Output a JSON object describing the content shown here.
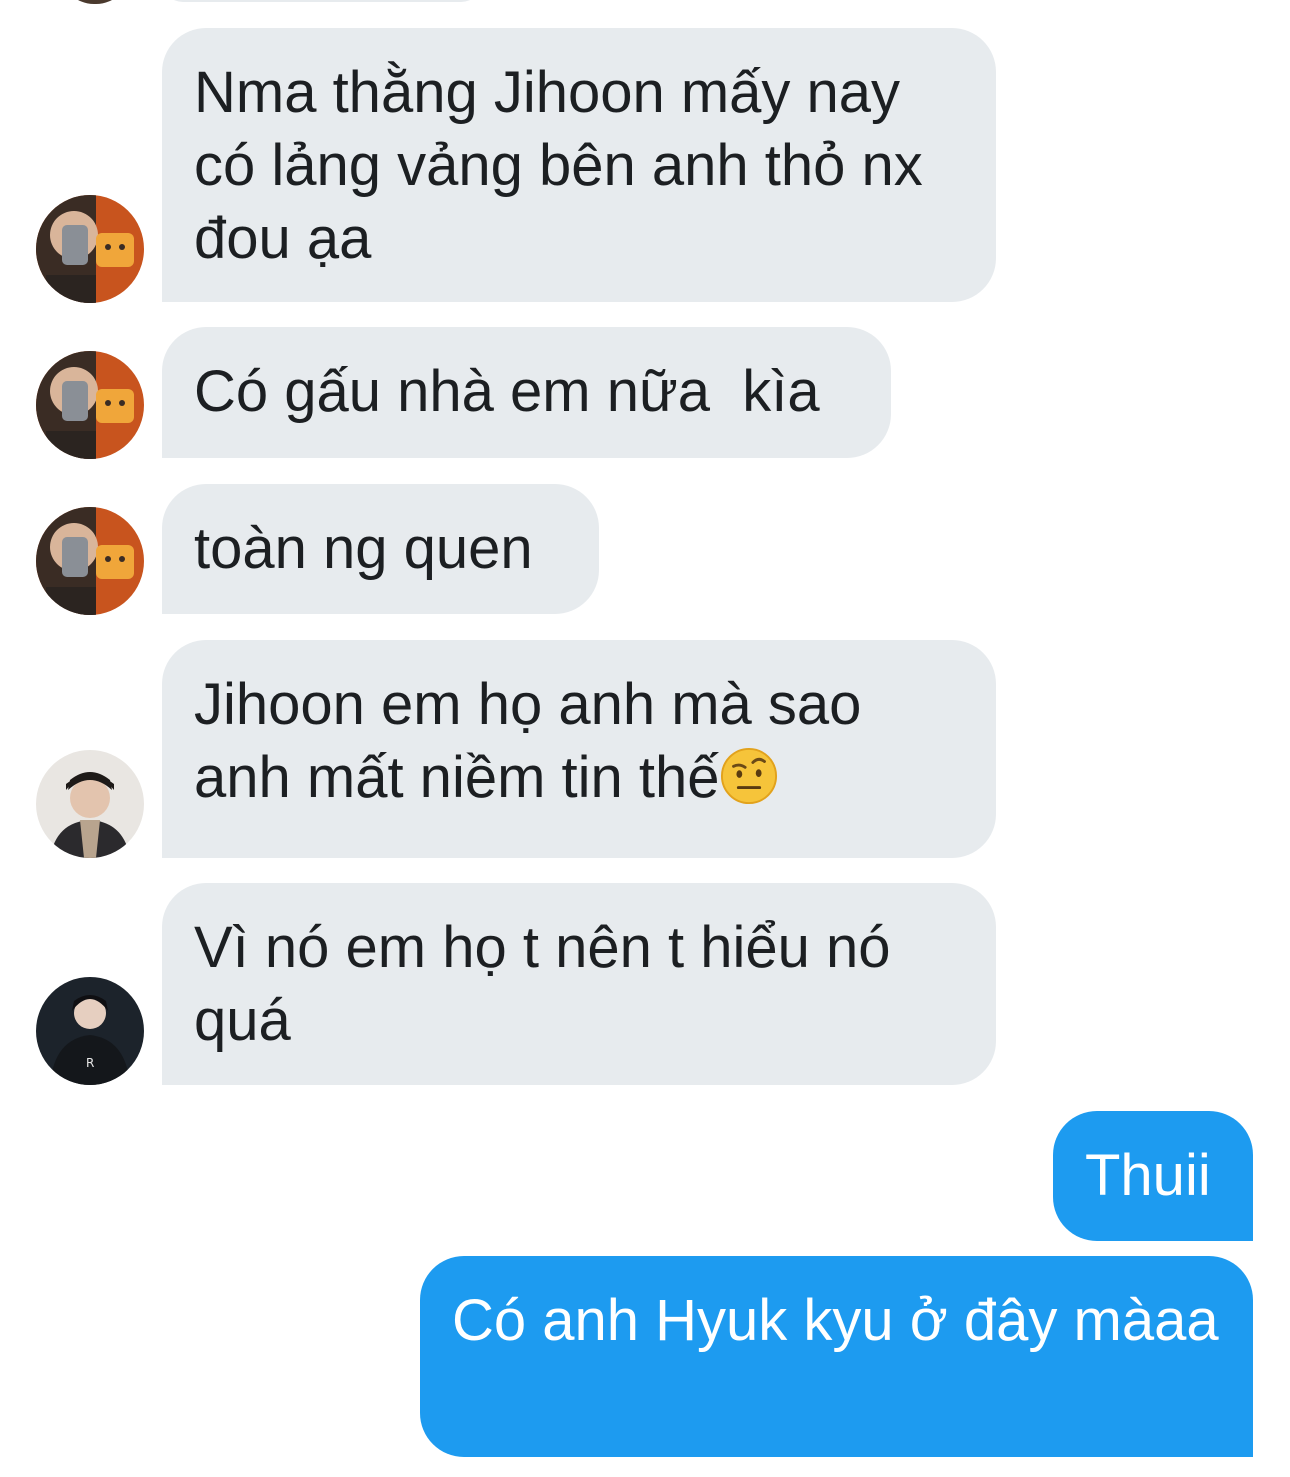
{
  "conversation": {
    "messages": [
      {
        "id": "m1",
        "direction": "incoming",
        "sender_avatar": "avatar-a",
        "text": "Nma thằng Jihoon mấy nay có lảng vảng bên anh thỏ nx đou ạa"
      },
      {
        "id": "m2",
        "direction": "incoming",
        "sender_avatar": "avatar-a",
        "text": "Có gấu nhà em nữa  kìa"
      },
      {
        "id": "m3",
        "direction": "incoming",
        "sender_avatar": "avatar-a",
        "text": "toàn ng quen"
      },
      {
        "id": "m4",
        "direction": "incoming",
        "sender_avatar": "avatar-b",
        "text_line1": "Jihoon em họ anh mà sao",
        "text_line2": "anh mất niềm tin thế",
        "emoji": "raised-eyebrow-face-icon"
      },
      {
        "id": "m5",
        "direction": "incoming",
        "sender_avatar": "avatar-c",
        "text": "Vì nó em họ t nên t hiểu nó quá"
      },
      {
        "id": "m6",
        "direction": "outgoing",
        "text": "Thuii"
      },
      {
        "id": "m7",
        "direction": "outgoing",
        "text": "Có anh Hyuk kyu ở đây màaa"
      }
    ]
  },
  "colors": {
    "incoming_bubble": "#e7ebee",
    "incoming_text": "#1c1f22",
    "outgoing_bubble": "#1d9bf0",
    "outgoing_text": "#ffffff",
    "background": "#ffffff"
  }
}
